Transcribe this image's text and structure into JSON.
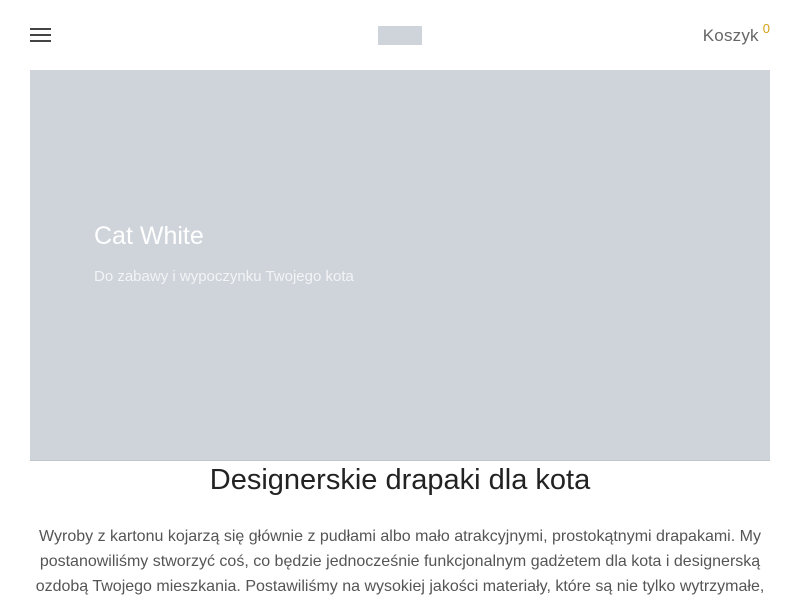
{
  "header": {
    "cart_label": "Koszyk",
    "cart_count": "0"
  },
  "hero": {
    "title": "Cat White",
    "subtitle": "Do zabawy i wypoczynku Twojego kota"
  },
  "section": {
    "title": "Designerskie drapaki dla kota",
    "body": "Wyroby z kartonu kojarzą się głównie z pudłami albo mało atrakcyjnymi, prostokątnymi drapakami. My postanowiliśmy stworzyć coś, co będzie jednocześnie funkcjonalnym gadżetem dla kota i designerską ozdobą Twojego mieszkania. Postawiliśmy na wysokiej jakości materiały, które są nie tylko wytrzymałe,"
  },
  "colors": {
    "hero_bg": "#cfd4db",
    "cart_badge": "#d4a017"
  },
  "icons": {
    "menu": "hamburger-menu-icon"
  }
}
